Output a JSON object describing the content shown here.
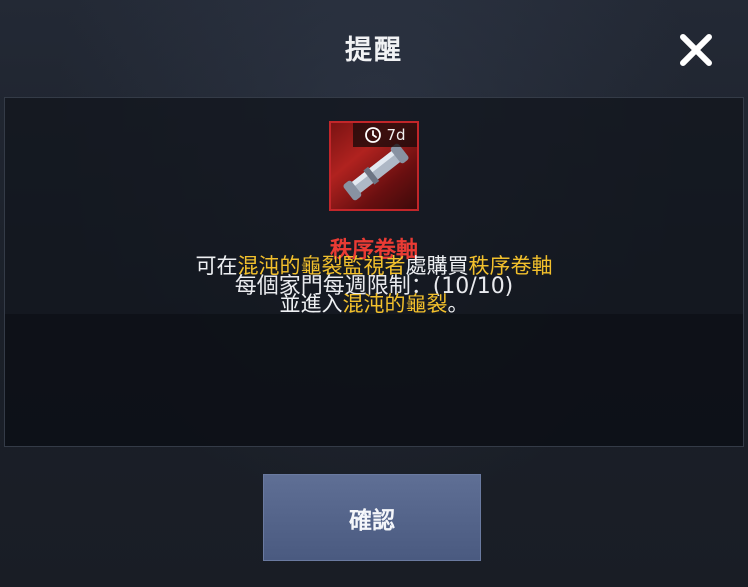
{
  "dialog": {
    "title": "提醒",
    "close_icon": "close-icon"
  },
  "item": {
    "icon": "scroll-icon",
    "timer_icon": "clock-icon",
    "duration": "7d",
    "name": "秩序卷軸",
    "limit_text": "每個家門每週限制：(10/10)"
  },
  "info": {
    "line1_part1": "可在",
    "line1_highlight1": "混沌的龜裂監視者",
    "line1_part2": "處購買",
    "line1_highlight2": "秩序卷軸",
    "line2_part1": "並進入",
    "line2_highlight1": "混沌的龜裂",
    "line2_part2": "。"
  },
  "buttons": {
    "confirm_label": "確認"
  },
  "colors": {
    "item_name": "#ea3b34",
    "highlight": "#f2c02c",
    "button": "#55658b"
  }
}
